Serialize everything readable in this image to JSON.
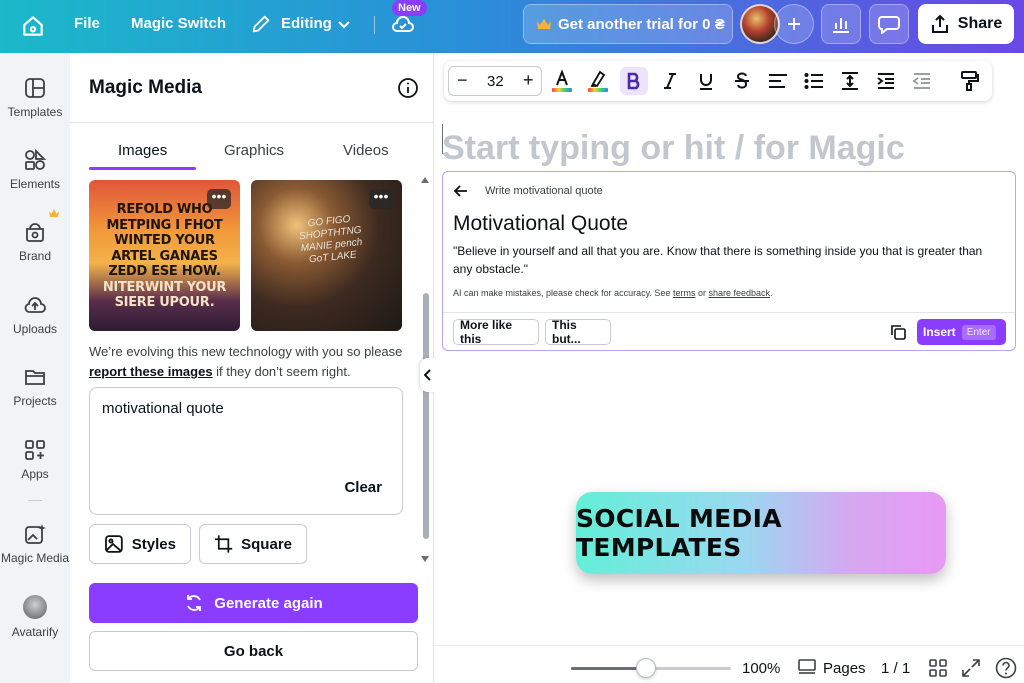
{
  "topbar": {
    "file": "File",
    "magic_switch": "Magic Switch",
    "editing": "Editing",
    "new_badge": "New",
    "trial": "Get another trial for 0 ₴",
    "share": "Share"
  },
  "rail": {
    "items": [
      {
        "label": "Templates",
        "icon": "templates-icon"
      },
      {
        "label": "Elements",
        "icon": "elements-icon"
      },
      {
        "label": "Brand",
        "icon": "brand-icon"
      },
      {
        "label": "Uploads",
        "icon": "uploads-icon"
      },
      {
        "label": "Projects",
        "icon": "folder-icon"
      },
      {
        "label": "Apps",
        "icon": "apps-icon"
      },
      {
        "label": "Magic Media",
        "icon": "magic-media-icon"
      },
      {
        "label": "Avatarify",
        "icon": "avatar"
      }
    ]
  },
  "panel": {
    "title": "Magic Media",
    "tabs": [
      "Images",
      "Graphics",
      "Videos"
    ],
    "active_tab": "Images",
    "thumb1_text_lines": [
      "REFOLD WHO",
      "METPING I FHOT",
      "WINTED YOUR",
      "ARTEL GANAES",
      "ZEDD ESE HOW.",
      "NITERWINT YOUR",
      "SIERE UPOUR."
    ],
    "thumb2_text": "GO FIGO SHOPTHTNG MANIE pench GoT LAKE",
    "disclaimer_pre": "We’re evolving this new technology with you so please",
    "disclaimer_link": "report these images",
    "disclaimer_post": "if they don’t seem right.",
    "prompt": "motivational quote",
    "clear": "Clear",
    "styles": "Styles",
    "square": "Square",
    "generate": "Generate again",
    "go_back": "Go back"
  },
  "toolbar": {
    "font_size": "32",
    "minus": "−",
    "plus": "+"
  },
  "canvas": {
    "placeholder": "Start typing or hit / for Magic",
    "badge": "SOCIAL MEDIA TEMPLATES"
  },
  "ai_card": {
    "crumb": "Write motivational quote",
    "title": "Motivational Quote",
    "quote": "\"Believe in yourself and all that you are. Know that there is something inside you that is greater than any obstacle.\"",
    "note_pre": "AI can make mistakes, please check for accuracy. See",
    "note_terms": "terms",
    "note_mid": "or",
    "note_feedback": "share feedback",
    "note_end": ".",
    "more_like_this": "More like this",
    "this_but": "This but...",
    "insert": "Insert",
    "enter": "Enter"
  },
  "bottombar": {
    "zoom": "100%",
    "zoom_level": 0.42,
    "pages": "Pages",
    "page_count": "1 / 1"
  },
  "colors": {
    "accent": "#8b3dff",
    "topbar_start": "#1bb9c9",
    "topbar_end": "#6a48e6"
  }
}
